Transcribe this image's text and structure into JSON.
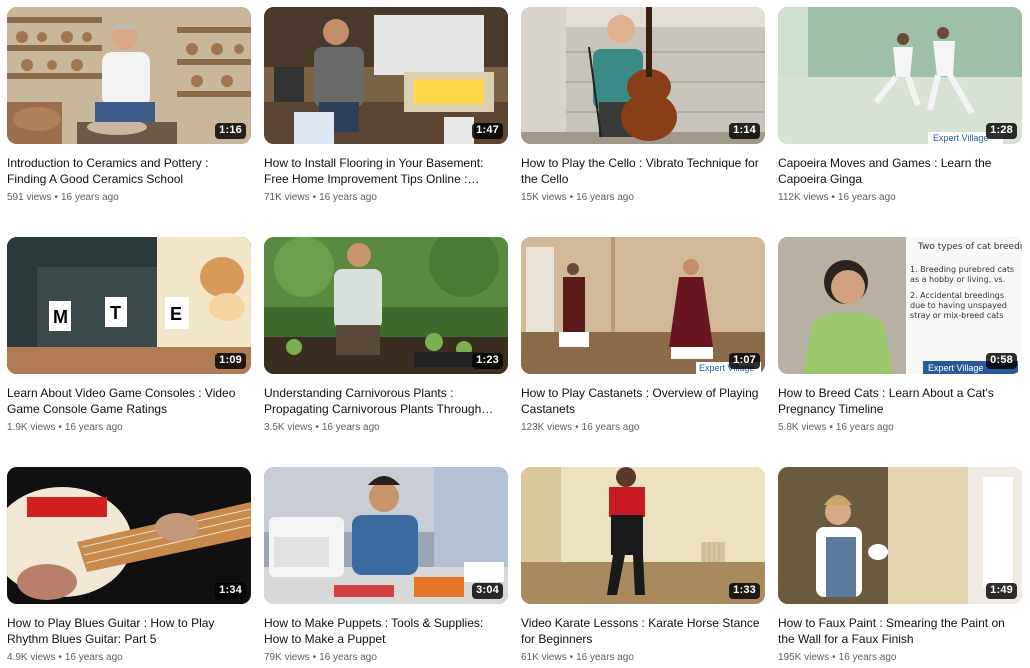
{
  "videos": [
    {
      "title": "Introduction to Ceramics and Pottery : Finding A Good Ceramics School",
      "duration": "1:16",
      "views": "591 views",
      "age": "16 years ago",
      "thumb": "ceramics-thumbnail"
    },
    {
      "title": "How to Install Flooring in Your Basement: Free Home Improvement Tips Online : Installing Baseboards",
      "duration": "1:47",
      "views": "71K views",
      "age": "16 years ago",
      "thumb": "flooring-thumbnail"
    },
    {
      "title": "How to Play the Cello : Vibrato Technique for the Cello",
      "duration": "1:14",
      "views": "15K views",
      "age": "16 years ago",
      "thumb": "cello-thumbnail"
    },
    {
      "title": "Capoeira Moves and Games : Learn the Capoeira Ginga",
      "duration": "1:28",
      "views": "112K views",
      "age": "16 years ago",
      "thumb": "capoeira-thumbnail"
    },
    {
      "title": "Learn About Video Game Consoles : Video Game Console Game Ratings",
      "duration": "1:09",
      "views": "1.9K views",
      "age": "16 years ago",
      "thumb": "game-ratings-thumbnail"
    },
    {
      "title": "Understanding Carnivorous Plants : Propagating Carnivorous Plants Through Division",
      "duration": "1:23",
      "views": "3.5K views",
      "age": "16 years ago",
      "thumb": "plants-thumbnail"
    },
    {
      "title": "How to Play Castanets : Overview of Playing Castanets",
      "duration": "1:07",
      "views": "123K views",
      "age": "16 years ago",
      "thumb": "castanets-thumbnail"
    },
    {
      "title": "How to Breed Cats : Learn About a Cat's Pregnancy Timeline",
      "duration": "0:58",
      "views": "5.8K views",
      "age": "16 years ago",
      "thumb": "cats-thumbnail"
    },
    {
      "title": "How to Play Blues Guitar : How to Play Rhythm Blues Guitar: Part 5",
      "duration": "1:34",
      "views": "4.9K views",
      "age": "16 years ago",
      "thumb": "guitar-thumbnail"
    },
    {
      "title": "How to Make Puppets : Tools & Supplies: How to Make a Puppet",
      "duration": "3:04",
      "views": "79K views",
      "age": "16 years ago",
      "thumb": "puppets-thumbnail"
    },
    {
      "title": "Video Karate Lessons : Karate Horse Stance for Beginners",
      "duration": "1:33",
      "views": "61K views",
      "age": "16 years ago",
      "thumb": "karate-thumbnail"
    },
    {
      "title": "How to Faux Paint : Smearing the Paint on the Wall for a Faux Finish",
      "duration": "1:49",
      "views": "195K views",
      "age": "16 years ago",
      "thumb": "faux-paint-thumbnail"
    }
  ],
  "overlays": {
    "capoeira": "Expert Village",
    "castanets": "Expert Village",
    "cats": "Expert Village",
    "whiteboard_heading": "Two types of cat breeding:",
    "whiteboard_line1": "1. Breeding purebred cats as a hobby or living, vs.",
    "whiteboard_line2": "2. Accidental breedings due to having unspayed stray or mix-breed cats",
    "rating_m": "M",
    "rating_t": "T",
    "rating_e": "E"
  },
  "separator": "•"
}
